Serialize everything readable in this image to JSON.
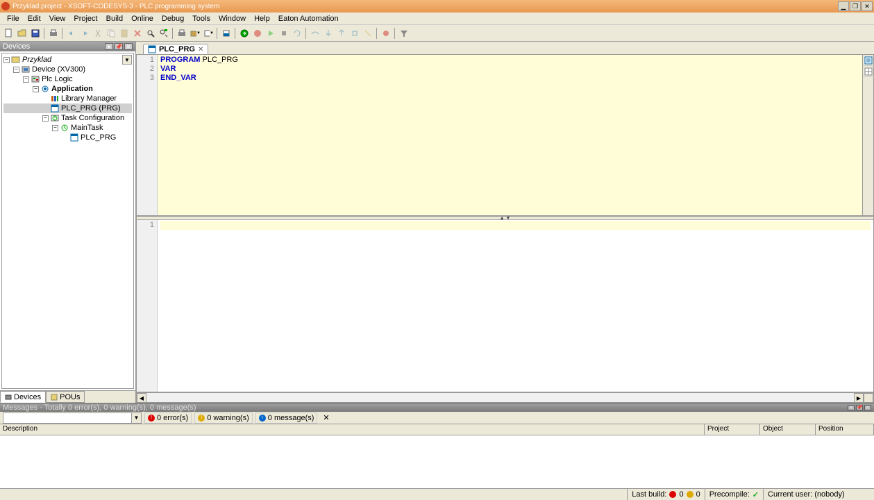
{
  "title": "Przyklad.project - XSOFT-CODESYS-3 - PLC programming system",
  "menu": [
    "File",
    "Edit",
    "View",
    "Project",
    "Build",
    "Online",
    "Debug",
    "Tools",
    "Window",
    "Help",
    "Eaton Automation"
  ],
  "devices_panel": {
    "title": "Devices",
    "tree": [
      {
        "label": "Przyklad",
        "indent": 0,
        "expand": "-",
        "icon": "project",
        "italic": true
      },
      {
        "label": "Device (XV300)",
        "indent": 1,
        "expand": "-",
        "icon": "device"
      },
      {
        "label": "Plc Logic",
        "indent": 2,
        "expand": "-",
        "icon": "logic"
      },
      {
        "label": "Application",
        "indent": 3,
        "expand": "-",
        "icon": "app",
        "bold": true
      },
      {
        "label": "Library Manager",
        "indent": 4,
        "expand": "",
        "icon": "lib"
      },
      {
        "label": "PLC_PRG (PRG)",
        "indent": 4,
        "expand": "",
        "icon": "pou",
        "selected": true
      },
      {
        "label": "Task Configuration",
        "indent": 4,
        "expand": "-",
        "icon": "task"
      },
      {
        "label": "MainTask",
        "indent": 5,
        "expand": "-",
        "icon": "maintask"
      },
      {
        "label": "PLC_PRG",
        "indent": 6,
        "expand": "",
        "icon": "pou"
      }
    ],
    "tabs": [
      {
        "label": "Devices",
        "active": true
      },
      {
        "label": "POUs",
        "active": false
      }
    ]
  },
  "editor": {
    "tab_label": "PLC_PRG",
    "declaration": {
      "lines": [
        {
          "n": "1",
          "tokens": [
            {
              "t": "PROGRAM",
              "c": "kw"
            },
            {
              "t": " ",
              "c": ""
            },
            {
              "t": "PLC_PRG",
              "c": "ident"
            }
          ]
        },
        {
          "n": "2",
          "tokens": [
            {
              "t": "VAR",
              "c": "kw"
            }
          ]
        },
        {
          "n": "3",
          "tokens": [
            {
              "t": "END_VAR",
              "c": "kw"
            }
          ]
        }
      ]
    },
    "body": {
      "lines": [
        {
          "n": "1",
          "tokens": []
        }
      ]
    }
  },
  "messages": {
    "header": "Messages - Totally 0 error(s), 0 warning(s), 0 message(s)",
    "filters": {
      "errors": "0 error(s)",
      "warnings": "0 warning(s)",
      "messages": "0 message(s)"
    },
    "columns": {
      "desc": "Description",
      "proj": "Project",
      "obj": "Object",
      "pos": "Position"
    }
  },
  "status": {
    "lastbuild": "Last build:",
    "err": "0",
    "warn": "0",
    "precompile": "Precompile:",
    "user": "Current user: (nobody)"
  }
}
